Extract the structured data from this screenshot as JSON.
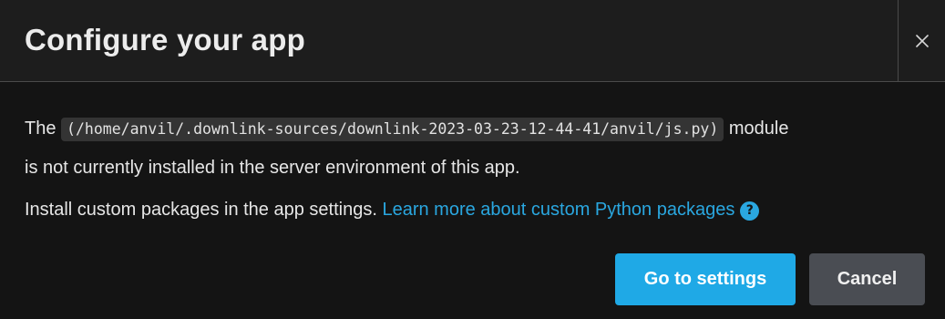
{
  "dialog": {
    "title": "Configure your app",
    "close_icon": "close-icon"
  },
  "message": {
    "prefix": "The",
    "module_path": "(/home/anvil/.downlink-sources/downlink-2023-03-23-12-44-41/anvil/js.py)",
    "suffix_first_line": "module",
    "second_line": "is not currently installed in the server environment of this app.",
    "install_text": "Install custom packages in the app settings.",
    "link_text": "Learn more about custom Python packages",
    "help_icon_glyph": "?"
  },
  "buttons": {
    "primary_label": "Go to settings",
    "cancel_label": "Cancel"
  },
  "colors": {
    "background": "#141414",
    "header_background": "#1d1d1d",
    "accent": "#1fa9e6",
    "link": "#2aa7e0",
    "secondary_button": "#4a4d53",
    "code_background": "#343434"
  }
}
